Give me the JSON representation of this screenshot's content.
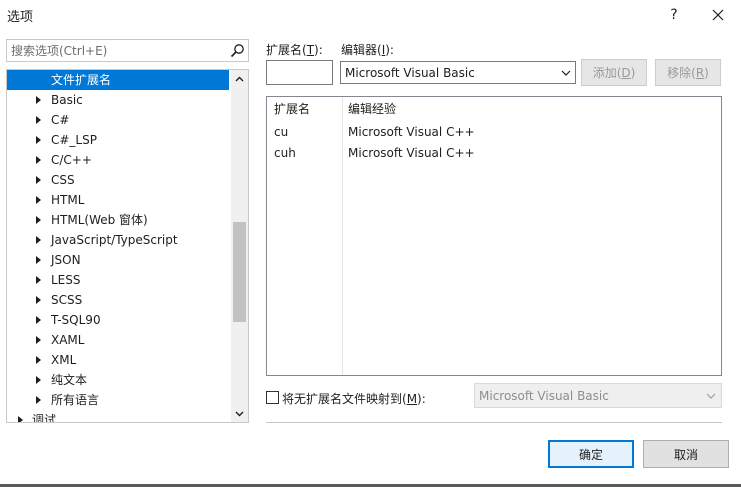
{
  "window": {
    "title": "选项",
    "help_glyph": "?"
  },
  "search": {
    "placeholder": "搜索选项(Ctrl+E)"
  },
  "tree": {
    "selected": "文件扩展名",
    "items": [
      {
        "label": "文件扩展名",
        "selected": true,
        "expandable": false
      },
      {
        "label": "Basic",
        "expandable": true
      },
      {
        "label": "C#",
        "expandable": true
      },
      {
        "label": "C#_LSP",
        "expandable": true
      },
      {
        "label": "C/C++",
        "expandable": true
      },
      {
        "label": "CSS",
        "expandable": true
      },
      {
        "label": "HTML",
        "expandable": true
      },
      {
        "label": "HTML(Web 窗体)",
        "expandable": true
      },
      {
        "label": "JavaScript/TypeScript",
        "expandable": true
      },
      {
        "label": "JSON",
        "expandable": true
      },
      {
        "label": "LESS",
        "expandable": true
      },
      {
        "label": "SCSS",
        "expandable": true
      },
      {
        "label": "T-SQL90",
        "expandable": true
      },
      {
        "label": "XAML",
        "expandable": true
      },
      {
        "label": "XML",
        "expandable": true
      },
      {
        "label": "纯文本",
        "expandable": true
      },
      {
        "label": "所有语言",
        "expandable": true
      },
      {
        "label": "调试",
        "expandable": true,
        "top_level": true
      }
    ]
  },
  "form": {
    "extension_label": "扩展名(",
    "extension_key": "T",
    "extension_label_end": "):",
    "extension_value": "",
    "editor_label": "编辑器(",
    "editor_key": "I",
    "editor_label_end": "):",
    "editor_value": "Microsoft Visual Basic",
    "add_label": "添加(",
    "add_key": "D",
    "add_end": ")",
    "remove_label": "移除(",
    "remove_key": "R",
    "remove_end": ")"
  },
  "list": {
    "headers": [
      "扩展名",
      "编辑经验"
    ],
    "rows": [
      {
        "ext": "cu",
        "editor": "Microsoft Visual C++"
      },
      {
        "ext": "cuh",
        "editor": "Microsoft Visual C++"
      }
    ]
  },
  "mapping": {
    "checkbox_label": "将无扩展名文件映射到(",
    "checkbox_key": "M",
    "checkbox_end": "):",
    "checked": false,
    "value": "Microsoft Visual Basic"
  },
  "buttons": {
    "ok": "确定",
    "cancel": "取消"
  }
}
